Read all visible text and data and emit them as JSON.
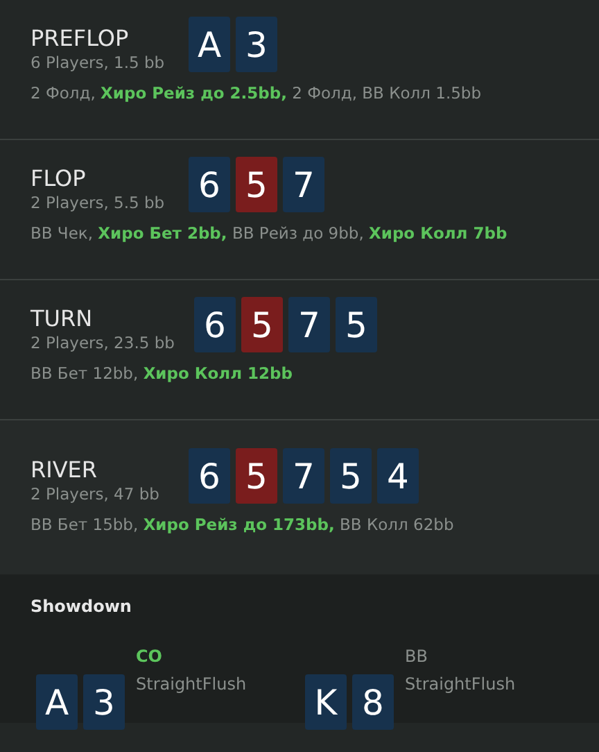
{
  "streets": [
    {
      "name": "PREFLOP",
      "info": "6 Players, 1.5 bb",
      "cards": [
        {
          "rank": "A",
          "color": "#17324d"
        },
        {
          "rank": "3",
          "color": "#17324d"
        }
      ],
      "actions": "2 Фолд, **Хиро Рейз до 2.5bb,** 2 Фолд, BB Колл 1.5bb",
      "highlighted": false
    },
    {
      "name": "FLOP",
      "info": "2 Players, 5.5 bb",
      "cards": [
        {
          "rank": "6",
          "color": "#17324d"
        },
        {
          "rank": "5",
          "color": "#7a1d1d"
        },
        {
          "rank": "7",
          "color": "#17324d"
        }
      ],
      "actions": "BB Чек, **Хиро Бет 2bb,** BB Рейз до 9bb, **Хиро Колл 7bb**",
      "highlighted": false
    },
    {
      "name": "TURN",
      "info": "2 Players, 23.5 bb",
      "cards": [
        {
          "rank": "6",
          "color": "#17324d"
        },
        {
          "rank": "5",
          "color": "#7a1d1d"
        },
        {
          "rank": "7",
          "color": "#17324d"
        },
        {
          "rank": "5",
          "color": "#17324d"
        }
      ],
      "actions": "BB Бет 12bb, **Хиро Колл 12bb**",
      "highlighted": false
    },
    {
      "name": "RIVER",
      "info": "2 Players, 47 bb",
      "cards": [
        {
          "rank": "6",
          "color": "#17324d"
        },
        {
          "rank": "5",
          "color": "#7a1d1d"
        },
        {
          "rank": "7",
          "color": "#17324d"
        },
        {
          "rank": "5",
          "color": "#17324d"
        },
        {
          "rank": "4",
          "color": "#17324d"
        }
      ],
      "actions": "BB Бет 15bb, **Хиро Рейз до 173bb,** BB Колл 62bb",
      "highlighted": true
    }
  ],
  "showdown": {
    "title": "Showdown",
    "players": [
      {
        "position": "CO",
        "hand": "StraightFlush",
        "winner": true,
        "cards": [
          {
            "rank": "A",
            "color": "#17324d"
          },
          {
            "rank": "3",
            "color": "#17324d"
          }
        ]
      },
      {
        "position": "BB",
        "hand": "StraightFlush",
        "winner": false,
        "cards": [
          {
            "rank": "K",
            "color": "#17324d"
          },
          {
            "rank": "8",
            "color": "#17324d"
          }
        ]
      }
    ]
  }
}
